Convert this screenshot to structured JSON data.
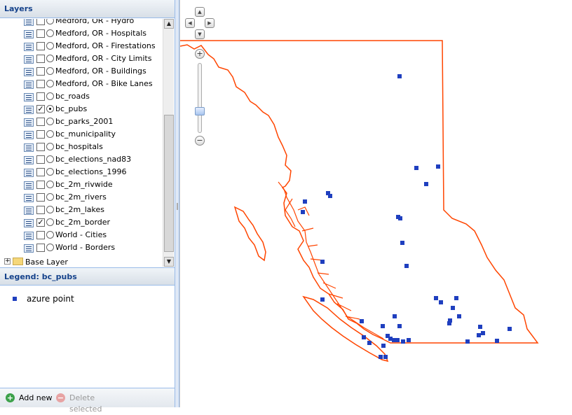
{
  "layers_panel": {
    "title": "Layers",
    "layers": [
      {
        "label": "Medford, OR - Hydro",
        "checked": false,
        "active": false
      },
      {
        "label": "Medford, OR - Hospitals",
        "checked": false,
        "active": false
      },
      {
        "label": "Medford, OR - Firestations",
        "checked": false,
        "active": false
      },
      {
        "label": "Medford, OR - City Limits",
        "checked": false,
        "active": false
      },
      {
        "label": "Medford, OR - Buildings",
        "checked": false,
        "active": false
      },
      {
        "label": "Medford, OR - Bike Lanes",
        "checked": false,
        "active": false
      },
      {
        "label": "bc_roads",
        "checked": false,
        "active": false
      },
      {
        "label": "bc_pubs",
        "checked": true,
        "active": true
      },
      {
        "label": "bc_parks_2001",
        "checked": false,
        "active": false
      },
      {
        "label": "bc_municipality",
        "checked": false,
        "active": false
      },
      {
        "label": "bc_hospitals",
        "checked": false,
        "active": false
      },
      {
        "label": "bc_elections_nad83",
        "checked": false,
        "active": false
      },
      {
        "label": "bc_elections_1996",
        "checked": false,
        "active": false
      },
      {
        "label": "bc_2m_rivwide",
        "checked": false,
        "active": false
      },
      {
        "label": "bc_2m_rivers",
        "checked": false,
        "active": false
      },
      {
        "label": "bc_2m_lakes",
        "checked": false,
        "active": false
      },
      {
        "label": "bc_2m_border",
        "checked": true,
        "active": false
      },
      {
        "label": "World - Cities",
        "checked": false,
        "active": false
      },
      {
        "label": "World - Borders",
        "checked": false,
        "active": false
      }
    ],
    "base_layer_label": "Base Layer"
  },
  "legend_panel": {
    "title": "Legend: bc_pubs",
    "items": [
      {
        "label": "azure point",
        "color": "#1f3fbf"
      }
    ]
  },
  "toolbar": {
    "add_label": "Add new",
    "delete_label": "Delete selected"
  },
  "map": {
    "border_color": "#ff4500",
    "point_color": "#1f3fbf",
    "zoom_in_icon": "+",
    "zoom_out_icon": "−"
  }
}
